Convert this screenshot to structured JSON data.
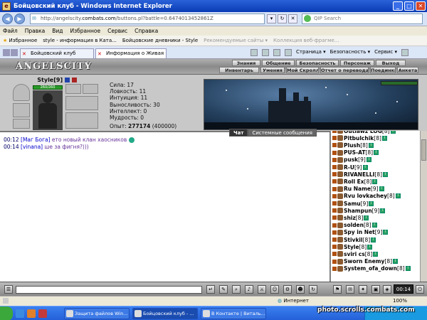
{
  "window": {
    "title": "Бойцовский клуб - Windows Internet Explorer"
  },
  "address": {
    "url_prefix": "http://angelscity.",
    "url_domain": "combats.com",
    "url_rest": "/buttons.pl?battle=0.6474013452861Z",
    "search_placeholder": "QIP Search"
  },
  "menu": [
    "Файл",
    "Правка",
    "Вид",
    "Избранное",
    "Сервис",
    "Справка"
  ],
  "favorites": {
    "label": "Избранное",
    "items": [
      "style - информация в Ката...",
      "Бойцовские дневники - Style",
      "Рекомендуемые сайты ▾",
      "Коллекция веб-фрагме..."
    ]
  },
  "tabs": [
    {
      "label": "Бойцовский клуб"
    },
    {
      "label": "Информация о Живая"
    }
  ],
  "ietools": [
    "Страница ▾",
    "Безопасность ▾",
    "Сервис ▾"
  ],
  "game": {
    "logo": "ANGELSCITY",
    "menu_row1": [
      "Знания",
      "Общение",
      "Безопасность",
      "Персонаж",
      "Выход"
    ],
    "menu_row2": [
      "Инвентарь",
      "Умения",
      "Мой Скролл",
      "Отчет о переводах",
      "Поединки",
      "Анкета"
    ],
    "character": {
      "name": "Style",
      "level": "[9]",
      "hp": "260/260",
      "stats": [
        "Сила: 17",
        "Ловкость: 11",
        "Интуиция: 11",
        "Выносливость: 30",
        "Интеллект: 0",
        "Мудрость: 0"
      ],
      "exp_label": "Опыт:",
      "exp_value": "277174",
      "exp_next": "(400000)"
    },
    "chat_tabs": {
      "chat": "Чат",
      "system": "Системные сообщения"
    },
    "chat": [
      {
        "time": "00:12",
        "nick": "[Маг Бога]",
        "text": " ето новый клан хаосников"
      },
      {
        "time": "00:14",
        "nick": "[vinana]",
        "text": " ше за фигня?)))"
      }
    ],
    "online": [
      {
        "name": "Outlawz LOG",
        "level": "[8]"
      },
      {
        "name": "Pitbulchik",
        "level": "[8]"
      },
      {
        "name": "Plush",
        "level": "[8]"
      },
      {
        "name": "PUS-AT",
        "level": "[8]"
      },
      {
        "name": "pusk",
        "level": "[9]"
      },
      {
        "name": "R-U",
        "level": "[9]"
      },
      {
        "name": "RIVANELLI",
        "level": "[8]"
      },
      {
        "name": "Roll Ex",
        "level": "[8]"
      },
      {
        "name": "Ru Name",
        "level": "[9]"
      },
      {
        "name": "Rvu lovkachey",
        "level": "[8]"
      },
      {
        "name": "Samu",
        "level": "[9]"
      },
      {
        "name": "Shampun",
        "level": "[9]"
      },
      {
        "name": "shiz",
        "level": "[8]"
      },
      {
        "name": "solden",
        "level": "[8]"
      },
      {
        "name": "Spy in Net",
        "level": "[9]"
      },
      {
        "name": "Stivkil",
        "level": "[8]"
      },
      {
        "name": "Style",
        "level": "[8]"
      },
      {
        "name": "sviri cs",
        "level": "[8]"
      },
      {
        "name": "Sworn Enemy",
        "level": "[8]"
      },
      {
        "name": "System_ofa_down",
        "level": "[8]"
      }
    ],
    "clock": "00:14"
  },
  "status": {
    "zone": "Интернет",
    "zoom": "100%"
  },
  "taskbar": {
    "items": [
      "Защита файлов Win...",
      "Бойцовский клуб - ...",
      "В Контакте | Виталь..."
    ]
  },
  "watermark": "photo.scrolls.combats.com"
}
